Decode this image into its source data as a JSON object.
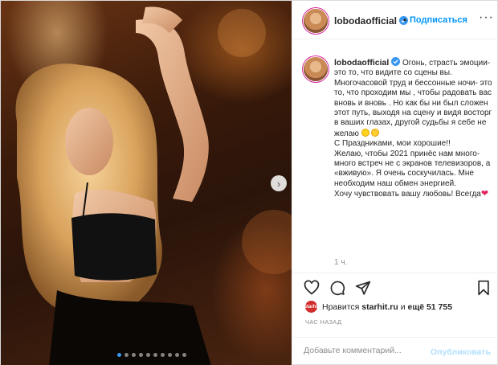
{
  "post": {
    "username": "lobodaofficial",
    "follow_label": "Подписаться",
    "separator": "•",
    "more_label": "···",
    "caption": {
      "username": "lobodaofficial",
      "part1": "Огонь, страсть эмоции- это то, что видите со сцены вы. Многочасовой труд и бессонные ночи- это то, что проходим мы , чтобы радовать вас вновь и вновь . Но как бы ни был сложен этот путь, выходя на сцену и видя восторг в ваших глазах, другой судьбы я себе не желаю",
      "part2": "С Праздниками, мои хорошие!!\nЖелаю, чтобы 2021 принёс нам много-много встреч не с экранов телевизоров, а «вживую». Я очень соскучилась. Мне необходим наш обмен энергией.\nХочу чувствовать вашу любовь! Всегда",
      "heart": "❤"
    },
    "time": "1 ч.",
    "likes": {
      "avatar_label": "Starhit",
      "prefix": "Нравится",
      "user": "starhit.ru",
      "middle": "и",
      "count": "ещё 51 755"
    },
    "ago": "ЧАС НАЗАД",
    "comment": {
      "placeholder": "Добавьте комментарий...",
      "publish_label": "Опубликовать"
    },
    "carousel": {
      "total": 10,
      "active": 1,
      "next_glyph": "›"
    },
    "colors": {
      "accent": "#0095f6",
      "verified": "#3897f0",
      "heart": "#e0245e",
      "muted": "#8e8e8e"
    },
    "icons": [
      "verified-badge-icon",
      "more-icon",
      "heart-icon",
      "comment-icon",
      "share-icon",
      "bookmark-icon",
      "chevron-right-icon"
    ]
  }
}
